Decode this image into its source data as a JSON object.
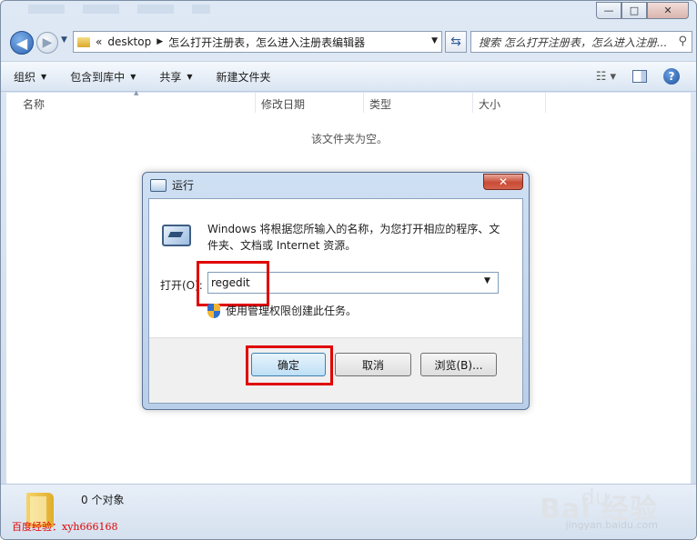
{
  "window": {
    "caption": {
      "minimize": "—",
      "maximize": "□",
      "close": "✕"
    }
  },
  "navbar": {
    "back_glyph": "◀",
    "forward_glyph": "▶",
    "history_glyph": "▼",
    "breadcrumb_prefix": "«",
    "breadcrumb": [
      "desktop",
      "怎么打开注册表，怎么进入注册表编辑器"
    ],
    "breadcrumb_sep": "▶",
    "address_dropdown": "▼",
    "refresh_glyph": "⇆",
    "search_placeholder": "搜索 怎么打开注册表，怎么进入注册...",
    "search_glyph": "⚲"
  },
  "toolbar": {
    "items": [
      "组织",
      "包含到库中",
      "共享",
      "新建文件夹"
    ],
    "dropdown_glyph": "▼",
    "view_glyph": "☷ ▾",
    "help_glyph": "?"
  },
  "columns": {
    "name": "名称",
    "date": "修改日期",
    "type": "类型",
    "size": "大小",
    "sort_glyph": "▲"
  },
  "content": {
    "empty_message": "该文件夹为空。"
  },
  "statusbar": {
    "item_count": "0 个对象",
    "watermark_left": "百度经验：xyh666168",
    "baidu_text": "Bai  经验",
    "baidu_paw": "du",
    "baidu_url": "jingyan.baidu.com"
  },
  "run_dialog": {
    "title": "运行",
    "close_glyph": "✕",
    "description": "Windows 将根据您所输入的名称，为您打开相应的程序、文件夹、文档或 Internet 资源。",
    "open_label": "打开(O):",
    "input_value": "regedit",
    "input_dropdown": "▼",
    "admin_note": "使用管理权限创建此任务。",
    "buttons": {
      "ok": "确定",
      "cancel": "取消",
      "browse": "浏览(B)..."
    }
  },
  "colors": {
    "highlight": "#e00000",
    "accent": "#2c63b4"
  }
}
